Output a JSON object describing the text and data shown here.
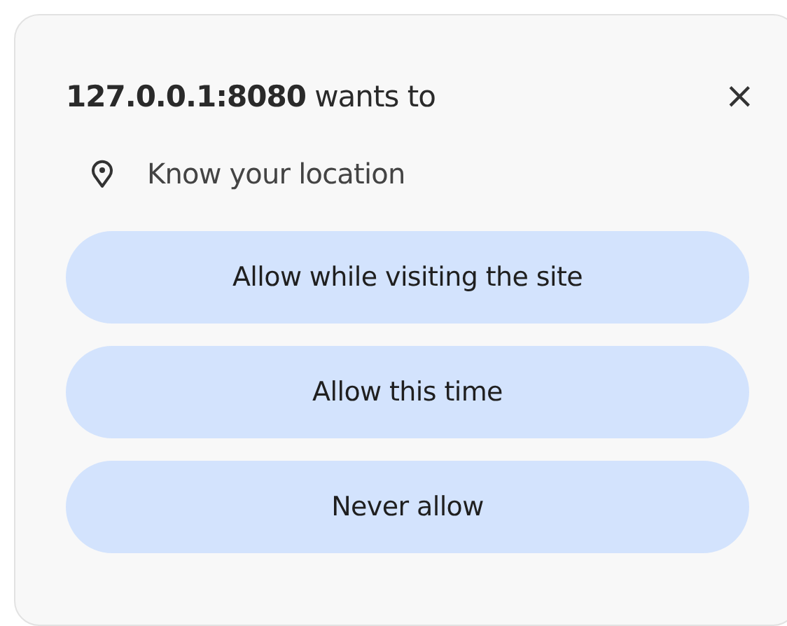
{
  "prompt": {
    "title": "**127.0.0.1:8080** wants to",
    "close": "×",
    "permission": "Know your location"
  },
  "buttons": [
    "Allow while visiting the site",
    "Allow this time",
    "Never allow"
  ]
}
